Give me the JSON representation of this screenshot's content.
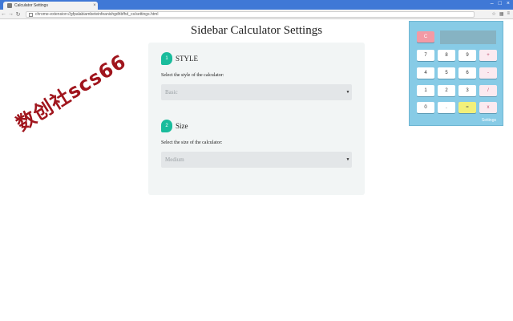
{
  "browser": {
    "tab_title": "Calculator Settings",
    "tab_close": "×",
    "window_controls": [
      "–",
      "□",
      "×"
    ],
    "nav": {
      "back": "←",
      "forward": "→",
      "reload": "↻"
    },
    "url": "chrome-extension://gfpalabiambeteinfeanishgdhbfhd_cs/settings.html",
    "toolbar_icons": [
      "☆",
      "▦",
      "≡"
    ]
  },
  "page": {
    "title": "Sidebar Calculator Settings",
    "sections": [
      {
        "step": "1",
        "label": "STYLE",
        "field_label": "Select the style of the calculator:",
        "value": "Basic",
        "caret": "▼"
      },
      {
        "step": "2",
        "label": "Size",
        "field_label": "Select the size of the calculator:",
        "value": "Medium",
        "caret": "▼"
      }
    ]
  },
  "watermark": "数创社scs66",
  "calculator": {
    "clear": "C",
    "keys": [
      [
        "7",
        "8",
        "9",
        "+"
      ],
      [
        "4",
        "5",
        "6",
        "-"
      ],
      [
        "1",
        "2",
        "3",
        "/"
      ],
      [
        "0",
        ".",
        "=",
        "x"
      ]
    ],
    "settings_link": "Settings"
  },
  "colors": {
    "browser_blue": "#3f78d6",
    "step_badge": "#1abc9c",
    "calc_bg": "#87cbe6",
    "calc_clear": "#f39aa5",
    "calc_equals": "#f2f07a",
    "watermark": "#a0151d"
  }
}
